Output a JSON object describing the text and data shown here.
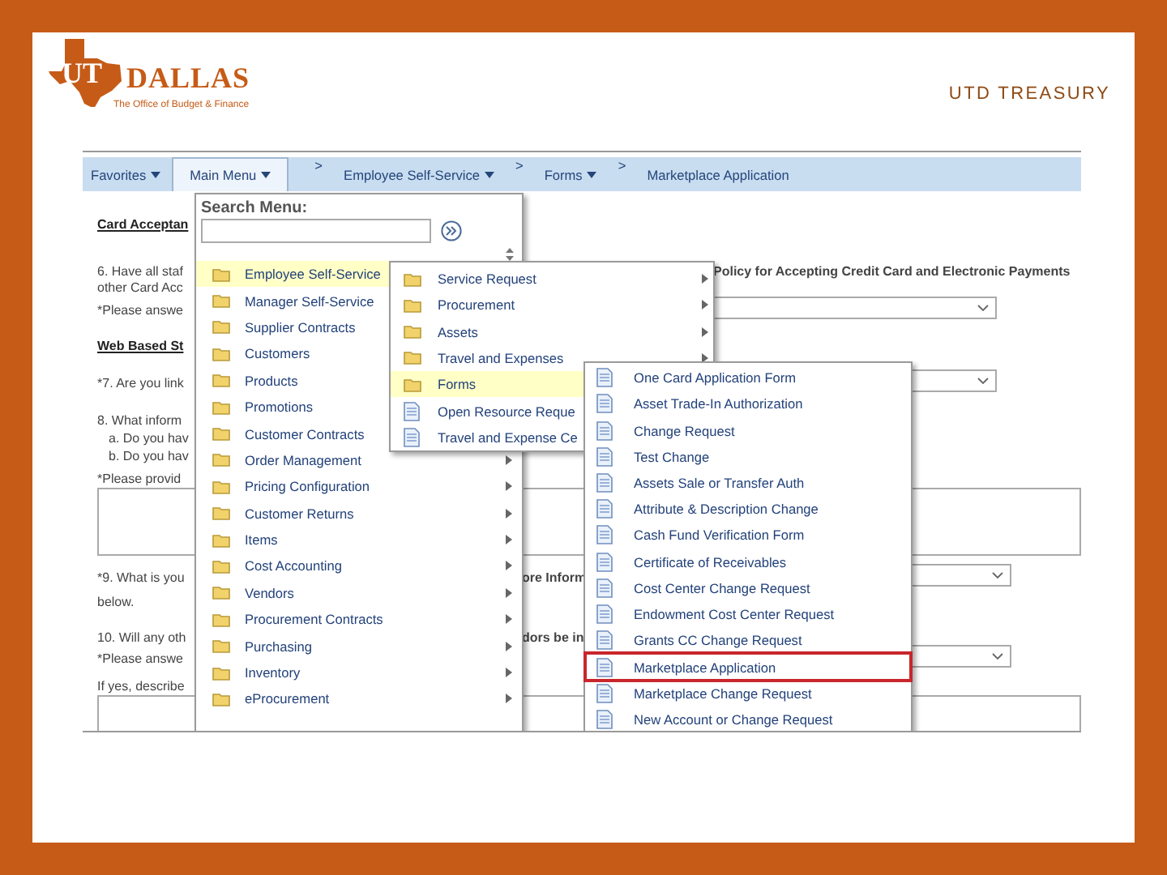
{
  "header": {
    "logo": {
      "mark": "UT",
      "name": "DALLAS",
      "subtitle": "The Office of Budget & Finance"
    },
    "title": "UTD TREASURY"
  },
  "nav": {
    "items": [
      {
        "label": "Favorites",
        "dropdown": true,
        "selected": false
      },
      {
        "label": "Main Menu",
        "dropdown": true,
        "selected": true
      },
      {
        "separator": ">",
        "label": "Employee Self-Service",
        "dropdown": true,
        "selected": false
      },
      {
        "separator": ">",
        "label": "Forms",
        "dropdown": true,
        "selected": false
      },
      {
        "separator": ">",
        "label": "Marketplace Application",
        "dropdown": false,
        "selected": false
      }
    ]
  },
  "form": {
    "rows": [
      {
        "kind": "heading",
        "text": "Card Acceptan"
      },
      {
        "kind": "text",
        "text": "6. Have all staf",
        "right": "Policy for Accepting Credit Card and Electronic Payments"
      },
      {
        "kind": "text",
        "text": "other Card Acc"
      },
      {
        "kind": "text_with_dropdown",
        "text": "*Please answe"
      },
      {
        "kind": "heading",
        "text": "Web Based St"
      },
      {
        "kind": "text_with_dropdown",
        "text": "*7. Are you link"
      },
      {
        "kind": "text",
        "text": "8. What inform"
      },
      {
        "kind": "subtext",
        "text": "a. Do you hav"
      },
      {
        "kind": "subtext",
        "text": "b. Do you hav"
      },
      {
        "kind": "text",
        "text": "*Please provid"
      },
      {
        "kind": "textarea"
      },
      {
        "kind": "text_with_dropdown",
        "text": "*9. What is you",
        "right": "ore Inform"
      },
      {
        "kind": "text",
        "text": "below."
      },
      {
        "kind": "text",
        "text": "10. Will any oth",
        "right": "dors be in"
      },
      {
        "kind": "text_with_dropdown",
        "text": "*Please answe"
      },
      {
        "kind": "text",
        "text": "If yes, describe"
      },
      {
        "kind": "textarea"
      }
    ]
  },
  "main_menu": {
    "search_label": "Search Menu:",
    "items": [
      {
        "label": "Employee Self-Service",
        "selected": true,
        "arrow": false
      },
      {
        "label": "Manager Self-Service",
        "selected": false,
        "arrow": false
      },
      {
        "label": "Supplier Contracts",
        "selected": false,
        "arrow": false
      },
      {
        "label": "Customers",
        "selected": false,
        "arrow": false
      },
      {
        "label": "Products",
        "selected": false,
        "arrow": false
      },
      {
        "label": "Promotions",
        "selected": false,
        "arrow": false
      },
      {
        "label": "Customer Contracts",
        "selected": false,
        "arrow": false
      },
      {
        "label": "Order Management",
        "selected": false,
        "arrow": true
      },
      {
        "label": "Pricing Configuration",
        "selected": false,
        "arrow": true
      },
      {
        "label": "Customer Returns",
        "selected": false,
        "arrow": true
      },
      {
        "label": "Items",
        "selected": false,
        "arrow": true
      },
      {
        "label": "Cost Accounting",
        "selected": false,
        "arrow": true
      },
      {
        "label": "Vendors",
        "selected": false,
        "arrow": true
      },
      {
        "label": "Procurement Contracts",
        "selected": false,
        "arrow": true
      },
      {
        "label": "Purchasing",
        "selected": false,
        "arrow": true
      },
      {
        "label": "Inventory",
        "selected": false,
        "arrow": true
      },
      {
        "label": "eProcurement",
        "selected": false,
        "arrow": true
      }
    ]
  },
  "submenu": {
    "items": [
      {
        "kind": "folder",
        "label": "Service Request",
        "selected": false,
        "arrow": true
      },
      {
        "kind": "folder",
        "label": "Procurement",
        "selected": false,
        "arrow": true
      },
      {
        "kind": "folder",
        "label": "Assets",
        "selected": false,
        "arrow": true
      },
      {
        "kind": "folder",
        "label": "Travel and Expenses",
        "selected": false,
        "arrow": true
      },
      {
        "kind": "folder",
        "label": "Forms",
        "selected": true,
        "arrow": false
      },
      {
        "kind": "page",
        "label": "Open Resource Reque",
        "selected": false,
        "arrow": false
      },
      {
        "kind": "page",
        "label": "Travel and Expense Ce",
        "selected": false,
        "arrow": false
      }
    ]
  },
  "forms_menu": {
    "items": [
      {
        "label": "One Card Application Form",
        "highlighted": false
      },
      {
        "label": "Asset Trade-In Authorization",
        "highlighted": false
      },
      {
        "label": "Change Request",
        "highlighted": false
      },
      {
        "label": "Test Change",
        "highlighted": false
      },
      {
        "label": "Assets Sale or Transfer Auth",
        "highlighted": false
      },
      {
        "label": "Attribute & Description Change",
        "highlighted": false
      },
      {
        "label": "Cash Fund Verification Form",
        "highlighted": false
      },
      {
        "label": "Certificate of Receivables",
        "highlighted": false
      },
      {
        "label": "Cost Center Change Request",
        "highlighted": false
      },
      {
        "label": "Endowment Cost Center Request",
        "highlighted": false
      },
      {
        "label": "Grants CC Change Request",
        "highlighted": false
      },
      {
        "label": "Marketplace Application",
        "highlighted": true
      },
      {
        "label": "Marketplace Change Request",
        "highlighted": false
      },
      {
        "label": "New Account or Change Request",
        "highlighted": false
      }
    ]
  }
}
